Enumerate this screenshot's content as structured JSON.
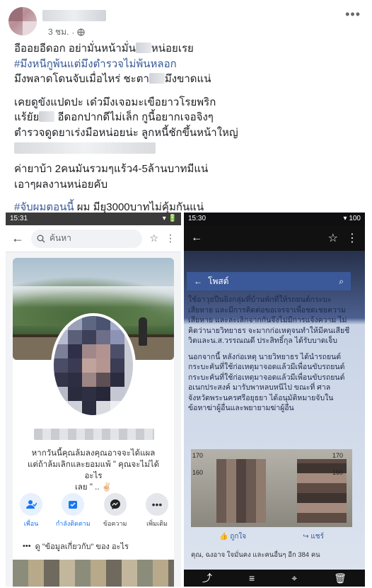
{
  "post": {
    "time": "3 ชม.",
    "more_label": "•••",
    "line1": "อีออยอีดอก อย่ามั่นหน้ามั่น",
    "line1b": "หน่อยเรย",
    "hashtag1": "#มึงหนีกูพ้นแต่มึงตำรวจไม่พ้นหลอก",
    "line3a": "มึงพลาดโดนจับเมื่อไหร่ ชะตา",
    "line3b": "มึงขาดแน่",
    "line4": "เคยดูขังแปดปะ เด๋วมึงเจอมะเขือยาวโรยพริก",
    "line5a": "แร้ยัย",
    "line5b": " อีดอกปากดีไม่เล็ก กูนี้อยากเจอจิงๆ",
    "line6": "ตำรวจดูดยาเร่งมือหน่อยน่ะ ลูกหนี้ชักขึ้นหน้าใหญ่",
    "line7": "ค่ายาบ้า 2คนมันรวมๆแร้ว4-5ล้านบาทมีแน่",
    "line8": "เอาๆผลงานหน่อยคับ",
    "hashtag2": "#จับผมตอนนี้",
    "line9": " ผม มียุ3000บาทไม่คุ้มกันแน่"
  },
  "shot1": {
    "status_time": "15:31",
    "status_right": "▾ 🔋",
    "search_placeholder": "ค้นหา",
    "bio_line1": "หากวันนี้คุณล้มลงคุณอาจจะได้แผล",
    "bio_line2": "แต่ถ้าล้มเลิกและยอมแพ้ \" คุณจะไม่ได้อะไร",
    "bio_line3": "เลย \" .. ✌🏻",
    "actions": [
      {
        "label": "เพื่อน",
        "icon": "friend-icon"
      },
      {
        "label": "กำลังติดตาม",
        "icon": "following-icon"
      },
      {
        "label": "ข้อความ",
        "icon": "messenger-icon"
      },
      {
        "label": "เพิ่มเติม",
        "icon": "more-icon"
      }
    ],
    "about_text": "ดู \"ข้อมูลเกี่ยวกับ\" ของ อะไร"
  },
  "shot2": {
    "status_time": "15:30",
    "status_right": "▾ 100",
    "inner_title": "โพสต์",
    "para1": [
      "ใช้อาวุธปืนยิงกลุ่มที่บ้านพักที่ให้รถยนต์กระบะ",
      "เสียหาย และมีการติดต่อขอเจรจาเพื่อชดเชยความ",
      "เสียหาย และละเลิกจากกันจึงไม่มีการแจ้งความ ไม่",
      "คิดว่านายวิทยาธร จะมากก่อเหตุจนทำให้มีคนเสียชี",
      "วิตและน.ส.วรรณณดี ประสิทธิ์กุล ได้รับบาดเจ็บ"
    ],
    "para2": [
      "นอกจากนี้ หลังก่อเหตุ นายวิทยาธร ได้นำรถยนต์",
      "กระบะคันที่ใช้ก่อเหตุมาจอดแล้วมีเพื่อนขับรถยนต์",
      "กระบะคันที่ใช้ก่อเหตุมาจอดแล้วมีเพื่อนขับรถยนต์",
      "อเนกประสงค์ มารับพาหลบหนีไป ขณะที่ ศาล",
      "จังหวัดพระนครศรีอยุธยา ได้อนุมัติหมายจับใน",
      "ข้อหาฆ่าผู้อื่นและพยายามฆ่าผู้อื่น"
    ],
    "scale_marks": [
      "170",
      "160",
      "170",
      "160"
    ],
    "like_label": "ถูกใจ",
    "share_label": "แชร์",
    "like_line": "คุณ, ฉงอาจ ใจมั่นคง และคนอื่นๆ อีก 384 คน"
  }
}
